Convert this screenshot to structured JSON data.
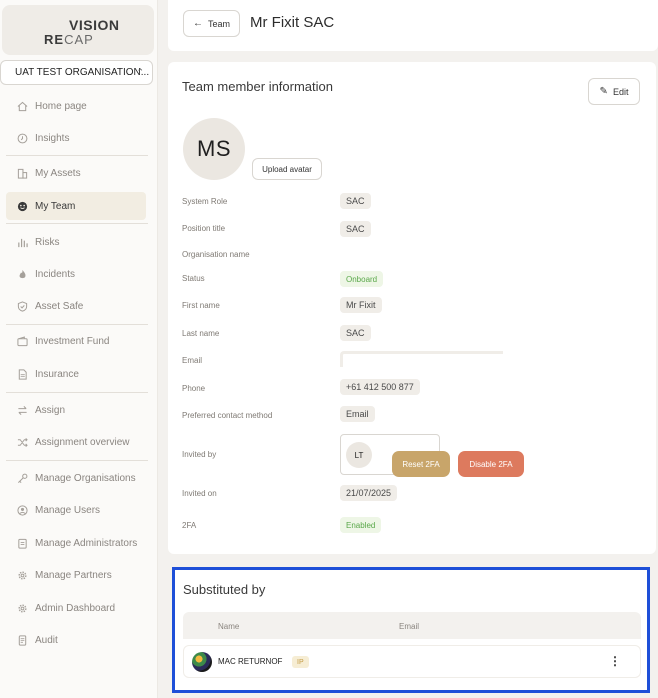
{
  "logo": {
    "top": "VISION",
    "bottom_a": "RE",
    "bottom_b": "CAP"
  },
  "org_select": {
    "value": "UAT TEST ORGANISATION..."
  },
  "sidebar": {
    "items": [
      {
        "label": "Home page",
        "icon": "home-icon"
      },
      {
        "label": "Insights",
        "icon": "clock-icon"
      },
      {
        "label": "My Assets",
        "icon": "building-icon"
      },
      {
        "label": "My Team",
        "icon": "smiley-icon",
        "active": true
      },
      {
        "label": "Risks",
        "icon": "bar-chart-icon"
      },
      {
        "label": "Incidents",
        "icon": "flame-icon"
      },
      {
        "label": "Asset Safe",
        "icon": "shield-icon"
      },
      {
        "label": "Investment Fund",
        "icon": "wallet-icon"
      },
      {
        "label": "Insurance",
        "icon": "document-icon"
      },
      {
        "label": "Assign",
        "icon": "swap-icon"
      },
      {
        "label": "Assignment overview",
        "icon": "shuffle-icon"
      },
      {
        "label": "Manage Organisations",
        "icon": "key-icon"
      },
      {
        "label": "Manage Users",
        "icon": "user-circle-icon"
      },
      {
        "label": "Manage Administrators",
        "icon": "clipboard-icon"
      },
      {
        "label": "Manage Partners",
        "icon": "gear-icon"
      },
      {
        "label": "Admin Dashboard",
        "icon": "gear-icon"
      },
      {
        "label": "Audit",
        "icon": "file-icon"
      }
    ]
  },
  "header": {
    "back_label": "Team",
    "title": "Mr Fixit SAC"
  },
  "info": {
    "title": "Team member information",
    "edit_label": "Edit",
    "initials": "MS",
    "upload_label": "Upload avatar",
    "fields": {
      "system_role": {
        "label": "System Role",
        "value": "SAC"
      },
      "position_title": {
        "label": "Position title",
        "value": "SAC"
      },
      "organisation_name": {
        "label": "Organisation name",
        "value": ""
      },
      "status": {
        "label": "Status",
        "value": "Onboard"
      },
      "first_name": {
        "label": "First name",
        "value": "Mr Fixit"
      },
      "last_name": {
        "label": "Last name",
        "value": "SAC"
      },
      "email": {
        "label": "Email",
        "value": ""
      },
      "phone": {
        "label": "Phone",
        "value": "+61 412 500 877"
      },
      "preferred_contact": {
        "label": "Preferred contact method",
        "value": "Email"
      },
      "invited_by": {
        "label": "Invited by",
        "initials": "LT"
      },
      "invited_on": {
        "label": "Invited on",
        "value": "21/07/2025"
      },
      "twofa": {
        "label": "2FA",
        "value": "Enabled",
        "reset_label": "Reset 2FA",
        "disable_label": "Disable 2FA"
      }
    }
  },
  "substituted": {
    "title": "Substituted by",
    "columns": [
      "Name",
      "Email"
    ],
    "rows": [
      {
        "name": "MAC RETURNOF",
        "tag": "IP",
        "email": ""
      }
    ],
    "menu_glyph": "⋮"
  },
  "colors": {
    "accent_gold": "#c8a56a",
    "danger": "#dd7a5e",
    "success": "#5aa84a",
    "highlight_border": "#1e4fd8"
  }
}
